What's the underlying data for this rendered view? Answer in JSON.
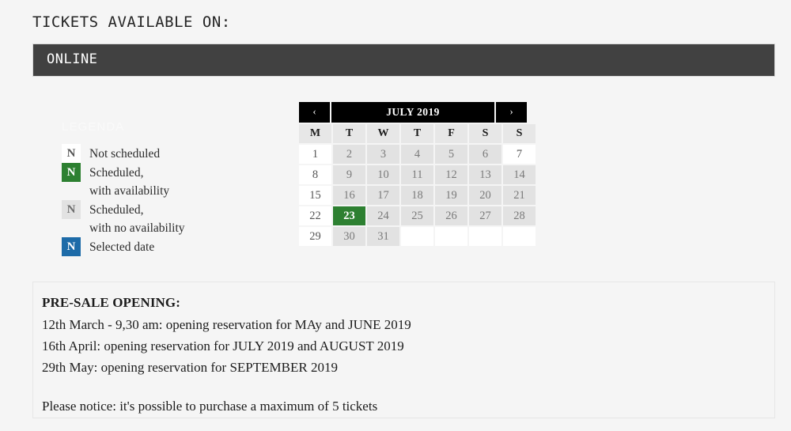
{
  "page": {
    "title": "TICKETS AVAILABLE ON:",
    "channel_label": "ONLINE"
  },
  "legend": {
    "title": "LEGENDA",
    "items": [
      {
        "glyph": "N",
        "state": "not-scheduled",
        "line1": "Not scheduled",
        "line2": "",
        "color": "#ffffff"
      },
      {
        "glyph": "N",
        "state": "available",
        "line1": "Scheduled,",
        "line2": "with availability",
        "color": "#2d8031"
      },
      {
        "glyph": "N",
        "state": "full",
        "line1": "Scheduled,",
        "line2": "with no availability",
        "color": "#e2e2e2"
      },
      {
        "glyph": "N",
        "state": "selected",
        "line1": "Selected date",
        "line2": "",
        "color": "#1d6ba8"
      }
    ]
  },
  "calendar": {
    "month_label": "JULY 2019",
    "prev_icon": "‹",
    "next_icon": "›",
    "weekday_headers": [
      "M",
      "T",
      "W",
      "T",
      "F",
      "S",
      "S"
    ],
    "weeks": [
      [
        {
          "day": "1",
          "state": "not-scheduled"
        },
        {
          "day": "2",
          "state": "full"
        },
        {
          "day": "3",
          "state": "full"
        },
        {
          "day": "4",
          "state": "full"
        },
        {
          "day": "5",
          "state": "full"
        },
        {
          "day": "6",
          "state": "full"
        },
        {
          "day": "7",
          "state": "not-scheduled"
        }
      ],
      [
        {
          "day": "8",
          "state": "not-scheduled"
        },
        {
          "day": "9",
          "state": "full"
        },
        {
          "day": "10",
          "state": "full"
        },
        {
          "day": "11",
          "state": "full"
        },
        {
          "day": "12",
          "state": "full"
        },
        {
          "day": "13",
          "state": "full"
        },
        {
          "day": "14",
          "state": "full"
        }
      ],
      [
        {
          "day": "15",
          "state": "not-scheduled"
        },
        {
          "day": "16",
          "state": "full"
        },
        {
          "day": "17",
          "state": "full"
        },
        {
          "day": "18",
          "state": "full"
        },
        {
          "day": "19",
          "state": "full"
        },
        {
          "day": "20",
          "state": "full"
        },
        {
          "day": "21",
          "state": "full"
        }
      ],
      [
        {
          "day": "22",
          "state": "not-scheduled"
        },
        {
          "day": "23",
          "state": "available"
        },
        {
          "day": "24",
          "state": "full"
        },
        {
          "day": "25",
          "state": "full"
        },
        {
          "day": "26",
          "state": "full"
        },
        {
          "day": "27",
          "state": "full"
        },
        {
          "day": "28",
          "state": "full"
        }
      ],
      [
        {
          "day": "29",
          "state": "not-scheduled"
        },
        {
          "day": "30",
          "state": "full"
        },
        {
          "day": "31",
          "state": "full"
        },
        {
          "day": "",
          "state": "empty"
        },
        {
          "day": "",
          "state": "empty"
        },
        {
          "day": "",
          "state": "empty"
        },
        {
          "day": "",
          "state": "empty"
        }
      ]
    ]
  },
  "info": {
    "heading": "PRE-SALE OPENING:",
    "lines": [
      "12th March - 9,30 am: opening reservation for MAy and JUNE 2019",
      "16th April: opening reservation for JULY 2019 and AUGUST 2019",
      "29th May: opening reservation for SEPTEMBER 2019"
    ],
    "notice": "Please notice: it's possible to purchase a maximum of 5 tickets"
  }
}
